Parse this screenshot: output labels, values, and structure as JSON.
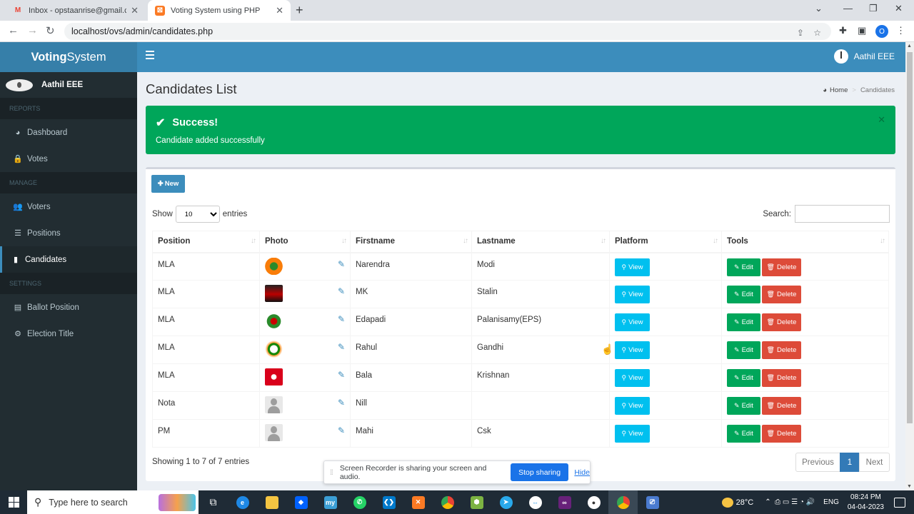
{
  "browser": {
    "tabs": [
      {
        "title": "Inbox - opstaanrise@gmail.com",
        "active": false
      },
      {
        "title": "Voting System using PHP",
        "active": true
      }
    ],
    "url": "localhost/ovs/admin/candidates.php",
    "profile_initial": "O"
  },
  "app": {
    "logo_bold": "Voting",
    "logo_rest": "System",
    "user_name": "Aathil EEE"
  },
  "sidebar": {
    "user_name": "Aathil EEE",
    "sections": [
      {
        "header": "REPORTS",
        "items": [
          {
            "label": "Dashboard",
            "icon": "dashboard-icon",
            "glyph": "◕",
            "active": false
          },
          {
            "label": "Votes",
            "icon": "lock-icon",
            "glyph": "🔒",
            "active": false
          }
        ]
      },
      {
        "header": "MANAGE",
        "items": [
          {
            "label": "Voters",
            "icon": "users-icon",
            "glyph": "👥",
            "active": false
          },
          {
            "label": "Positions",
            "icon": "tasks-icon",
            "glyph": "☰",
            "active": false
          },
          {
            "label": "Candidates",
            "icon": "black-tie-icon",
            "glyph": "▮",
            "active": true
          }
        ]
      },
      {
        "header": "SETTINGS",
        "items": [
          {
            "label": "Ballot Position",
            "icon": "file-text-icon",
            "glyph": "▤",
            "active": false
          },
          {
            "label": "Election Title",
            "icon": "cog-icon",
            "glyph": "⚙",
            "active": false
          }
        ]
      }
    ]
  },
  "page": {
    "title": "Candidates List",
    "breadcrumb_home": "Home",
    "breadcrumb_current": "Candidates"
  },
  "alert": {
    "title": "Success!",
    "message": "Candidate added successfully",
    "color": "#00a65a"
  },
  "table": {
    "new_button": "New",
    "show_label": "Show",
    "entries_value": "10",
    "entries_label": "entries",
    "search_label": "Search:",
    "columns": [
      "Position",
      "Photo",
      "Firstname",
      "Lastname",
      "Platform",
      "Tools"
    ],
    "view_label": "View",
    "edit_label": "Edit",
    "delete_label": "Delete",
    "rows": [
      {
        "position": "MLA",
        "photo": "bjp",
        "firstname": "Narendra",
        "lastname": "Modi"
      },
      {
        "position": "MLA",
        "photo": "dmk",
        "firstname": "MK",
        "lastname": "Stalin"
      },
      {
        "position": "MLA",
        "photo": "admk",
        "firstname": "Edapadi",
        "lastname": "Palanisamy(EPS)"
      },
      {
        "position": "MLA",
        "photo": "inc",
        "firstname": "Rahul",
        "lastname": "Gandhi"
      },
      {
        "position": "MLA",
        "photo": "cpi",
        "firstname": "Bala",
        "lastname": "Krishnan"
      },
      {
        "position": "Nota",
        "photo": "person",
        "firstname": "Nill",
        "lastname": ""
      },
      {
        "position": "PM",
        "photo": "person",
        "firstname": "Mahi",
        "lastname": "Csk"
      }
    ],
    "info": "Showing 1 to 7 of 7 entries",
    "pager_prev": "Previous",
    "pager_page": "1",
    "pager_next": "Next"
  },
  "share_bar": {
    "message": "Screen Recorder is sharing your screen and audio.",
    "stop_label": "Stop sharing",
    "hide_label": "Hide"
  },
  "taskbar": {
    "search_placeholder": "Type here to search",
    "weather": "28°C",
    "language": "ENG",
    "time": "08:24 PM",
    "date": "04-04-2023"
  }
}
